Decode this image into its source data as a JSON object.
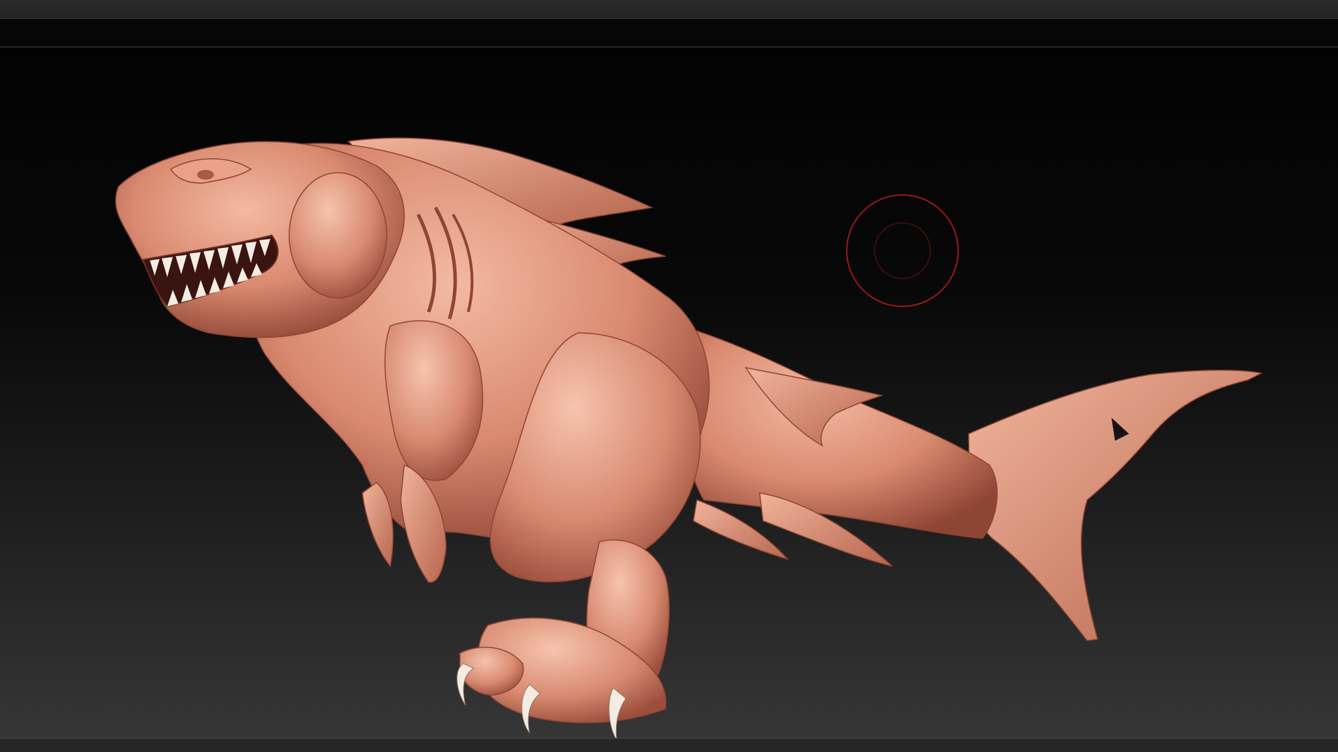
{
  "viewport": {
    "background_top": "#030303",
    "background_bottom": "#363636",
    "model": {
      "name": "shark-creature-sculpt",
      "material_base": "#d98a70",
      "material_light": "#f3b9a1",
      "material_shadow": "#8f4534",
      "teeth_color": "#f4ece2"
    },
    "brush_cursor": {
      "icon": "brush-cursor-icon",
      "color": "#9c1818"
    }
  }
}
